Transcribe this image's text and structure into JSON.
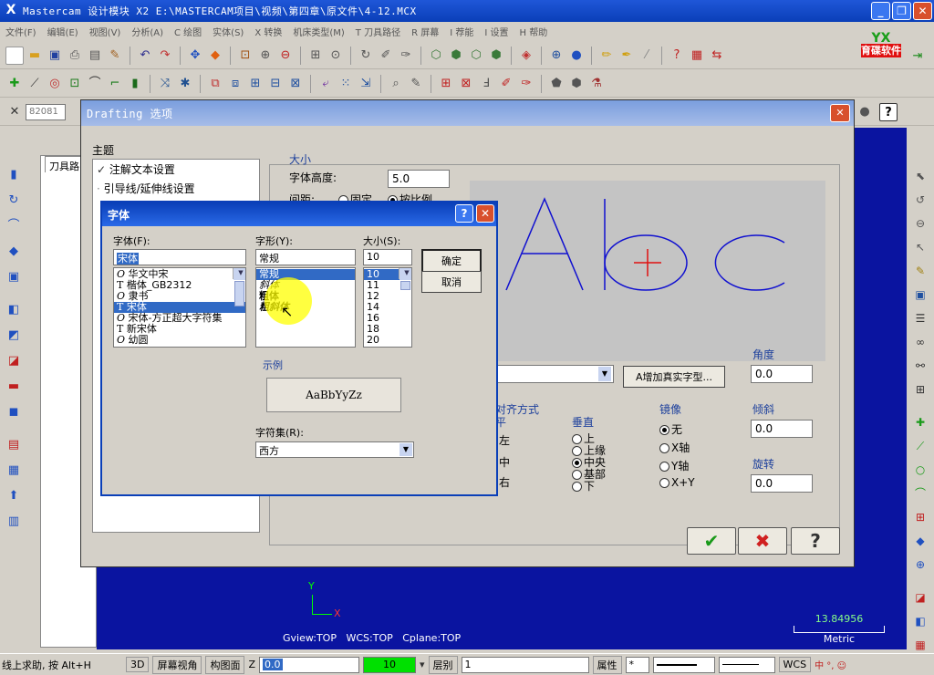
{
  "window": {
    "title": "Mastercam 设计模块  X2  E:\\MASTERCAM项目\\视频\\第四章\\原文件\\4-12.MCX",
    "minimize_glyph": "_",
    "restore_glyph": "❐",
    "close_glyph": "✕"
  },
  "menu": [
    "文件(F)",
    "编辑(E)",
    "视图(V)",
    "分析(A)",
    "C 绘图",
    "实体(S)",
    "X 转换",
    "机床类型(M)",
    "T 刀具路径",
    "R 屏幕",
    "I 荐能",
    "I 设置",
    "H 帮助"
  ],
  "toolbar3": {
    "field": "82081"
  },
  "logo": {
    "top": "YX",
    "text": "育碟软件"
  },
  "left_panel": {
    "tab": "刀具路"
  },
  "drafting": {
    "title": "Drafting 选项",
    "topic_label": "主题",
    "tree": [
      "注解文本设置",
      "引导线/延伸线设置"
    ],
    "size_group": "大小",
    "font_height_label": "字体高度:",
    "font_height_value": "5.0",
    "spacing_label": "间距:",
    "spacing_opt1": "固定",
    "spacing_opt2": "按比例",
    "preview_text": "Abc",
    "add_truetype_btn": "A增加真实字型...",
    "angle_label": "角度",
    "angle_value": "0.0",
    "align_label": "对齐方式",
    "horizontal_label": "平",
    "h_left": "左",
    "h_center": "中",
    "h_right": "右",
    "vertical_label": "垂直",
    "v_options": [
      "上",
      "上缘",
      "中央",
      "基部",
      "下"
    ],
    "v_selected": 2,
    "mirror_label": "镜像",
    "mirror_options": [
      "无",
      "X轴",
      "Y轴",
      "X+Y"
    ],
    "mirror_selected": 0,
    "slant_label": "倾斜",
    "slant_value": "0.0",
    "rotate_label": "旋转",
    "rotate_value": "0.0",
    "ok_glyph": "✔",
    "cancel_glyph": "✖",
    "help_glyph": "?"
  },
  "font_dialog": {
    "title": "字体",
    "font_label": "字体(F):",
    "font_value": "宋体",
    "fonts": [
      "华文中宋",
      "楷体_GB2312",
      "隶书",
      "宋体",
      "宋体-方正超大字符集",
      "新宋体",
      "幼圆"
    ],
    "font_selected": 3,
    "style_label": "字形(Y):",
    "style_value": "常规",
    "styles": [
      "常规",
      "斜体",
      "粗体",
      "粗斜体"
    ],
    "style_selected": 0,
    "size_label": "大小(S):",
    "size_value": "10",
    "sizes": [
      "10",
      "11",
      "12",
      "14",
      "16",
      "18",
      "20"
    ],
    "size_selected": 0,
    "ok": "确定",
    "cancel": "取消",
    "sample_label": "示例",
    "sample_text": "AaBbYyZz",
    "charset_label": "字符集(R):",
    "charset_value": "西方",
    "help_glyph": "?",
    "close_glyph": "✕"
  },
  "viewport": {
    "axis_y": "Y",
    "axis_x": "X",
    "gview": "Gview:TOP",
    "wcs": "WCS:TOP",
    "cplane": "Cplane:TOP",
    "scale_value": "13.84956",
    "scale_unit": "Metric"
  },
  "status": {
    "hint": "线上求助, 按 Alt+H",
    "btn_3d": "3D",
    "screen_view": "屏幕视角",
    "construct_plane": "构图面",
    "z_label": "Z",
    "z_value": "0.0",
    "color_value": "10",
    "layer_label": "层别",
    "layer_value": "1",
    "attr_label": "属性",
    "wcs_label": "WCS"
  },
  "colors": {
    "viewport": "#0a14a0",
    "preview_stroke": "#1010d0",
    "preview_cross": "#e01010",
    "selection": "#316ac5",
    "status_green": "#00e000"
  }
}
